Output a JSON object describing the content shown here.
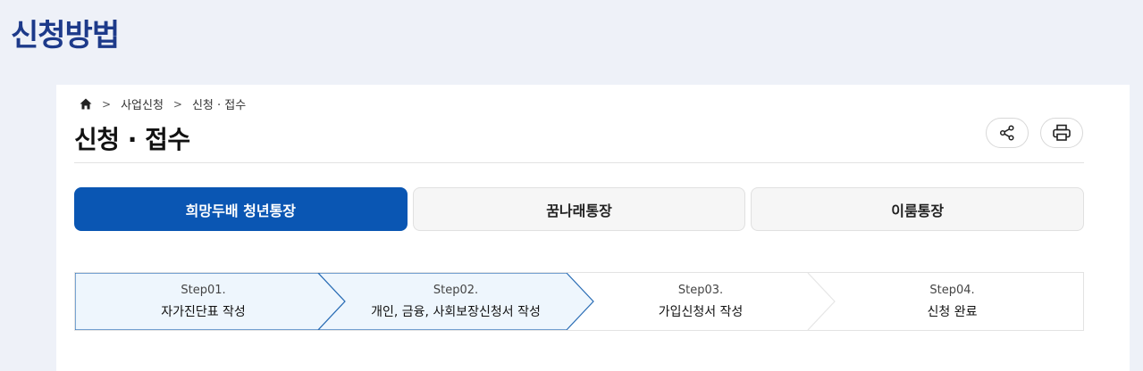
{
  "heading": "신청방법",
  "breadcrumb": {
    "home_icon": "home-icon",
    "items": [
      "사업신청",
      "신청 · 접수"
    ]
  },
  "page_title": "신청 · 접수",
  "tools": {
    "share_icon": "share-icon",
    "print_icon": "print-icon"
  },
  "tabs": [
    {
      "label": "희망두배 청년통장",
      "active": true
    },
    {
      "label": "꿈나래통장",
      "active": false
    },
    {
      "label": "이룸통장",
      "active": false
    }
  ],
  "steps": [
    {
      "num": "Step01.",
      "label": "자가진단표 작성",
      "state": "done"
    },
    {
      "num": "Step02.",
      "label": "개인, 금융, 사회보장신청서 작성",
      "state": "current"
    },
    {
      "num": "Step03.",
      "label": "가입신청서 작성",
      "state": "upcoming"
    },
    {
      "num": "Step04.",
      "label": "신청 완료",
      "state": "upcoming"
    }
  ],
  "colors": {
    "accent": "#0a56b3",
    "heading": "#1d3a8a",
    "step_active_bg": "#eef6fd",
    "step_active_border": "#2a6db5"
  }
}
